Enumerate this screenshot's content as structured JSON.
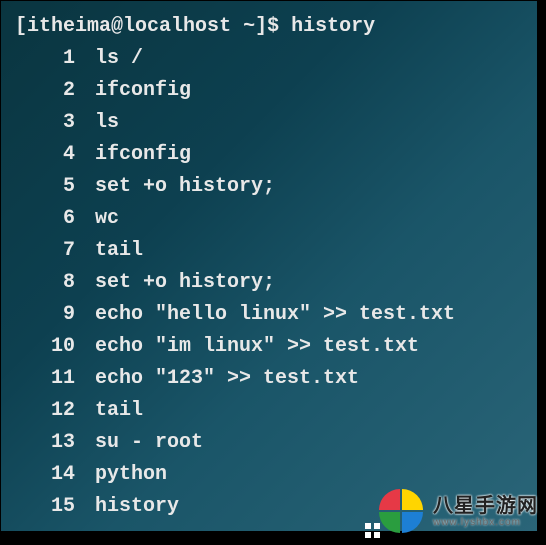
{
  "prompt": {
    "user": "itheima",
    "host": "localhost",
    "cwd": "~",
    "symbol": "$",
    "command": "history"
  },
  "history": [
    {
      "n": 1,
      "cmd": "ls /"
    },
    {
      "n": 2,
      "cmd": "ifconfig"
    },
    {
      "n": 3,
      "cmd": "ls"
    },
    {
      "n": 4,
      "cmd": "ifconfig"
    },
    {
      "n": 5,
      "cmd": "set +o history;"
    },
    {
      "n": 6,
      "cmd": "wc"
    },
    {
      "n": 7,
      "cmd": "tail"
    },
    {
      "n": 8,
      "cmd": "set +o history;"
    },
    {
      "n": 9,
      "cmd": "echo \"hello linux\" >> test.txt"
    },
    {
      "n": 10,
      "cmd": "echo \"im linux\" >> test.txt"
    },
    {
      "n": 11,
      "cmd": "echo \"123\" >> test.txt"
    },
    {
      "n": 12,
      "cmd": "tail"
    },
    {
      "n": 13,
      "cmd": "su - root"
    },
    {
      "n": 14,
      "cmd": "python"
    },
    {
      "n": 15,
      "cmd": "history"
    }
  ],
  "watermark": {
    "title": "八星手游网",
    "url": "www.lyshbx.com"
  }
}
